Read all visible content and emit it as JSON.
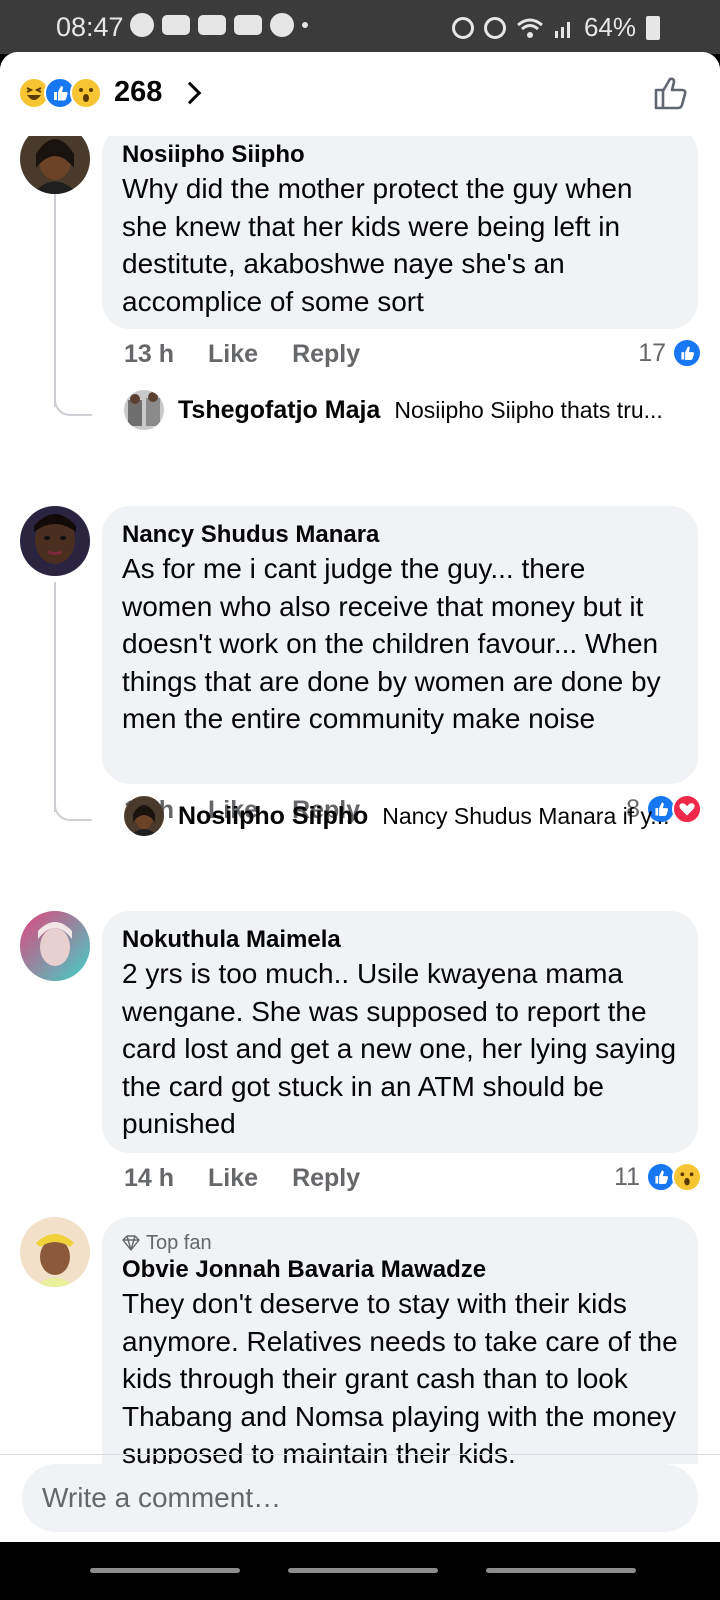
{
  "status_bar": {
    "time": "08:47",
    "battery": "64%"
  },
  "header": {
    "reaction_count": "268",
    "reaction_icons": [
      "haha",
      "like",
      "wow"
    ]
  },
  "comments": [
    {
      "name": "Nosiipho Siipho",
      "text": "Why did the mother protect the guy when she knew that her kids were being left in destitute, akaboshwe naye she's an accomplice of some sort",
      "time": "13 h",
      "like": "Like",
      "reply": "Reply",
      "reaction_count": "17",
      "reactions": [
        "like"
      ],
      "reply_preview": {
        "name": "Tshegofatjo Maja",
        "text": "Nosiipho Siipho thats tru..."
      }
    },
    {
      "name": "Nancy Shudus Manara",
      "text": "As for me i cant judge the guy... there women who also receive that money but it doesn't work on the children favour... When things that are done by women are done by men the entire community make noise",
      "time": "13 h",
      "like": "Like",
      "reply": "Reply",
      "reaction_count": "8",
      "reactions": [
        "like",
        "love"
      ],
      "reply_preview": {
        "name": "Nosiipho Siipho",
        "text": "Nancy Shudus Manara if y..."
      }
    },
    {
      "name": "Nokuthula Maimela",
      "text": "2 yrs is too much.. Usile kwayena mama wengane. She was supposed to report the card lost and get a new one, her lying saying the card got stuck in an ATM should be punished",
      "time": "14 h",
      "like": "Like",
      "reply": "Reply",
      "reaction_count": "11",
      "reactions": [
        "like",
        "wow"
      ]
    },
    {
      "badge": "Top fan",
      "name": "Obvie Jonnah Bavaria Mawadze",
      "text": "They don't deserve to stay with their kids anymore. Relatives needs to take care of the kids through their grant cash than to look Thabang and Nomsa playing with the money supposed to maintain their kids."
    }
  ],
  "composer": {
    "placeholder": "Write a comment…"
  }
}
